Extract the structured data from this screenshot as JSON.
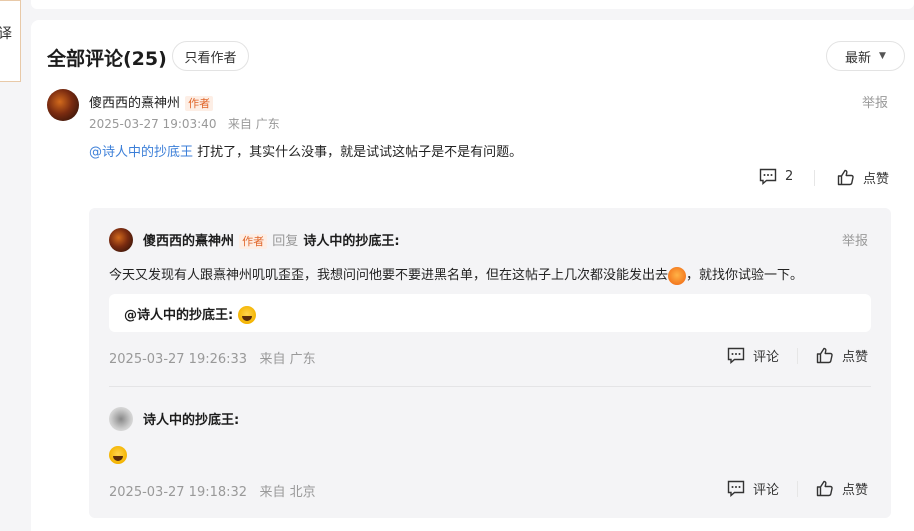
{
  "left_strip": {
    "text": "译"
  },
  "header": {
    "title": "全部评论(25)",
    "author_only_label": "只看作者",
    "sort_label": "最新"
  },
  "comment": {
    "user": "傻西西的熹神州",
    "badge": "作者",
    "time": "2025-03-27 19:03:40",
    "location": "来自 广东",
    "report": "举报",
    "mention": "@诗人中的抄底王",
    "text": " 打扰了，其实什么没事，就是试试这帖子是不是有问题。",
    "reply_count": "2",
    "like_label": "点赞"
  },
  "replies": [
    {
      "user": "傻西西的熹神州",
      "badge": "作者",
      "reply_word": "回复",
      "target": "诗人中的抄底王:",
      "report": "举报",
      "text_before": "今天又发现有人跟熹神州叽叽歪歪，我想问问他要不要进黑名单，但在这帖子上几次都没能发出去",
      "text_after": "，就找你试验一下。",
      "quote": "@诗人中的抄底王:",
      "time": "2025-03-27 19:26:33",
      "location": "来自 广东",
      "comment_label": "评论",
      "like_label": "点赞"
    },
    {
      "user": "诗人中的抄底王:",
      "time": "2025-03-27 19:18:32",
      "location": "来自 北京",
      "comment_label": "评论",
      "like_label": "点赞"
    }
  ],
  "colors": {
    "mention": "#3c7fd8",
    "badge": "#e0662a",
    "muted": "#999999"
  }
}
